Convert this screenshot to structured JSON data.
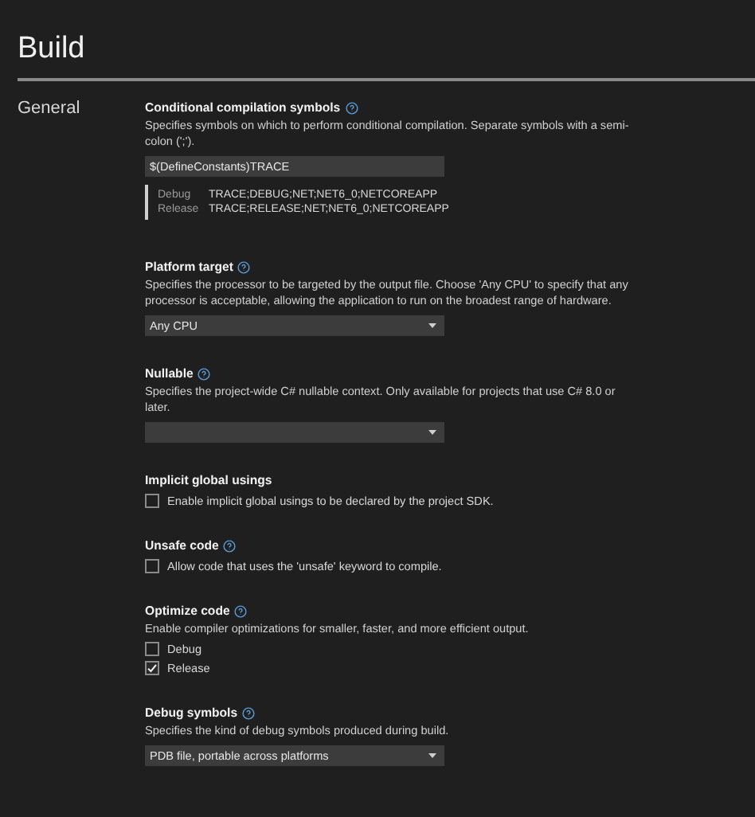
{
  "page_title": "Build",
  "category": "General",
  "sections": [
    {
      "kind": "text-field",
      "title": "Conditional compilation symbols",
      "help": true,
      "description": "Specifies symbols on which to perform conditional compilation. Separate symbols with a semi-colon (';').",
      "value": "$(DefineConstants)TRACE",
      "configurations": [
        {
          "name": "Debug",
          "value": "TRACE;DEBUG;NET;NET6_0;NETCOREAPP"
        },
        {
          "name": "Release",
          "value": "TRACE;RELEASE;NET;NET6_0;NETCOREAPP"
        }
      ]
    },
    {
      "kind": "dropdown",
      "title": "Platform target",
      "help": true,
      "description": "Specifies the processor to be targeted by the output file. Choose 'Any CPU' to specify that any processor is acceptable, allowing the application to run on the broadest range of hardware.",
      "value": "Any CPU"
    },
    {
      "kind": "dropdown",
      "title": "Nullable",
      "help": true,
      "description": "Specifies the project-wide C# nullable context. Only available for projects that use C# 8.0 or later."
    },
    {
      "kind": "checkbox",
      "title": "Implicit global usings",
      "help": false,
      "options": [
        {
          "label": "Enable implicit global usings to be declared by the project SDK.",
          "checked": false
        }
      ]
    },
    {
      "kind": "checkbox",
      "title": "Unsafe code",
      "help": true,
      "options": [
        {
          "label": "Allow code that uses the 'unsafe' keyword to compile.",
          "checked": false
        }
      ]
    },
    {
      "kind": "checkbox",
      "title": "Optimize code",
      "help": true,
      "description": "Enable compiler optimizations for smaller, faster, and more efficient output.",
      "options": [
        {
          "label": "Debug",
          "checked": false
        },
        {
          "label": "Release",
          "checked": true
        }
      ]
    },
    {
      "kind": "dropdown",
      "title": "Debug symbols",
      "help": true,
      "description": "Specifies the kind of debug symbols produced during build.",
      "value": "PDB file, portable across platforms"
    }
  ]
}
